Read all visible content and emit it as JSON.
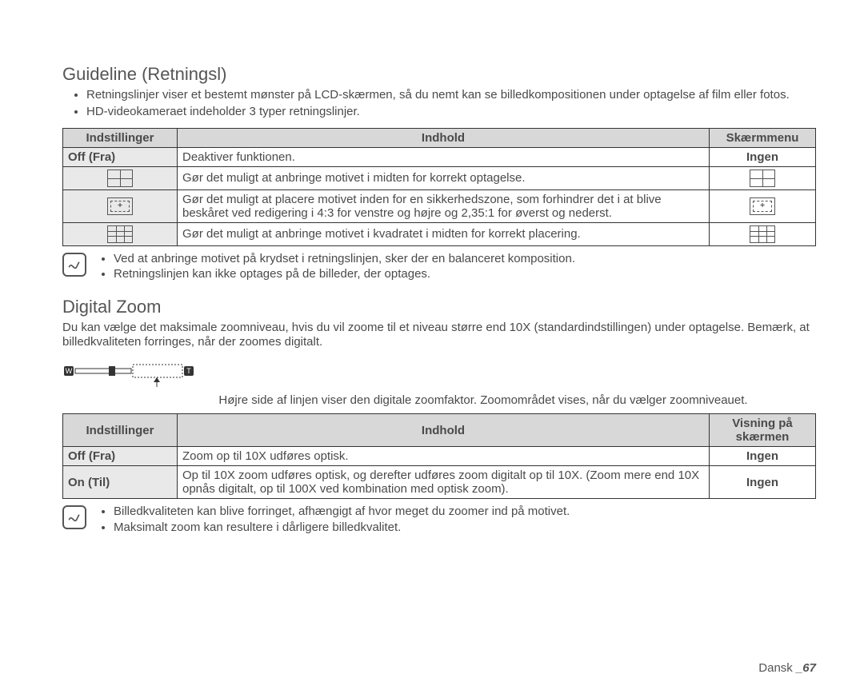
{
  "guideline": {
    "title": "Guideline (Retningsl)",
    "intro": [
      "Retningslinjer viser et bestemt mønster på LCD-skærmen, så du nemt kan se billedkompositionen under optagelse af film eller fotos.",
      "HD-videokameraet indeholder 3 typer retningslinjer."
    ],
    "th_set": "Indstillinger",
    "th_content": "Indhold",
    "th_disp": "Skærmmenu",
    "rows": [
      {
        "set": "Off (Fra)",
        "content": "Deaktiver funktionen.",
        "disp": "Ingen",
        "icon": ""
      },
      {
        "set": "",
        "content": "Gør det muligt at anbringe motivet i midten for korrekt optagelse.",
        "disp": "",
        "icon": "cross"
      },
      {
        "set": "",
        "content": "Gør det muligt at placere motivet inden for en sikkerhedszone, som forhindrer det i at blive beskåret ved redigering i 4:3 for venstre og højre og 2,35:1 for øverst og nederst.",
        "disp": "",
        "icon": "safe"
      },
      {
        "set": "",
        "content": "Gør det muligt at anbringe motivet i kvadratet i midten for korrekt placering.",
        "disp": "",
        "icon": "nine"
      }
    ],
    "notes": [
      "Ved at anbringe motivet på krydset i retningslinjen, sker der en balanceret komposition.",
      "Retningslinjen kan ikke optages på de billeder, der optages."
    ]
  },
  "zoom": {
    "title": "Digital Zoom",
    "intro": "Du kan vælge det maksimale zoomniveau, hvis du vil zoome til et niveau større end 10X (standardindstillingen) under optagelse. Bemærk, at billedkvaliteten forringes, når der zoomes digitalt.",
    "caption": "Højre side af linjen viser den digitale zoomfaktor. Zoomområdet vises, når du vælger zoomniveauet.",
    "th_set": "Indstillinger",
    "th_content": "Indhold",
    "th_disp": "Visning på skærmen",
    "rows": [
      {
        "set": "Off (Fra)",
        "content": "Zoom op til 10X udføres optisk.",
        "disp": "Ingen"
      },
      {
        "set": "On (Til)",
        "content": "Op til 10X zoom udføres optisk, og derefter udføres zoom digitalt op til 10X. (Zoom mere end 10X opnås digitalt, op til 100X ved kombination med optisk zoom).",
        "disp": "Ingen"
      }
    ],
    "notes": [
      "Billedkvaliteten kan blive forringet, afhængigt af hvor meget du zoomer ind på motivet.",
      "Maksimalt zoom kan resultere i dårligere billedkvalitet."
    ]
  },
  "footer": {
    "lang": "Dansk ",
    "page": "_67"
  }
}
